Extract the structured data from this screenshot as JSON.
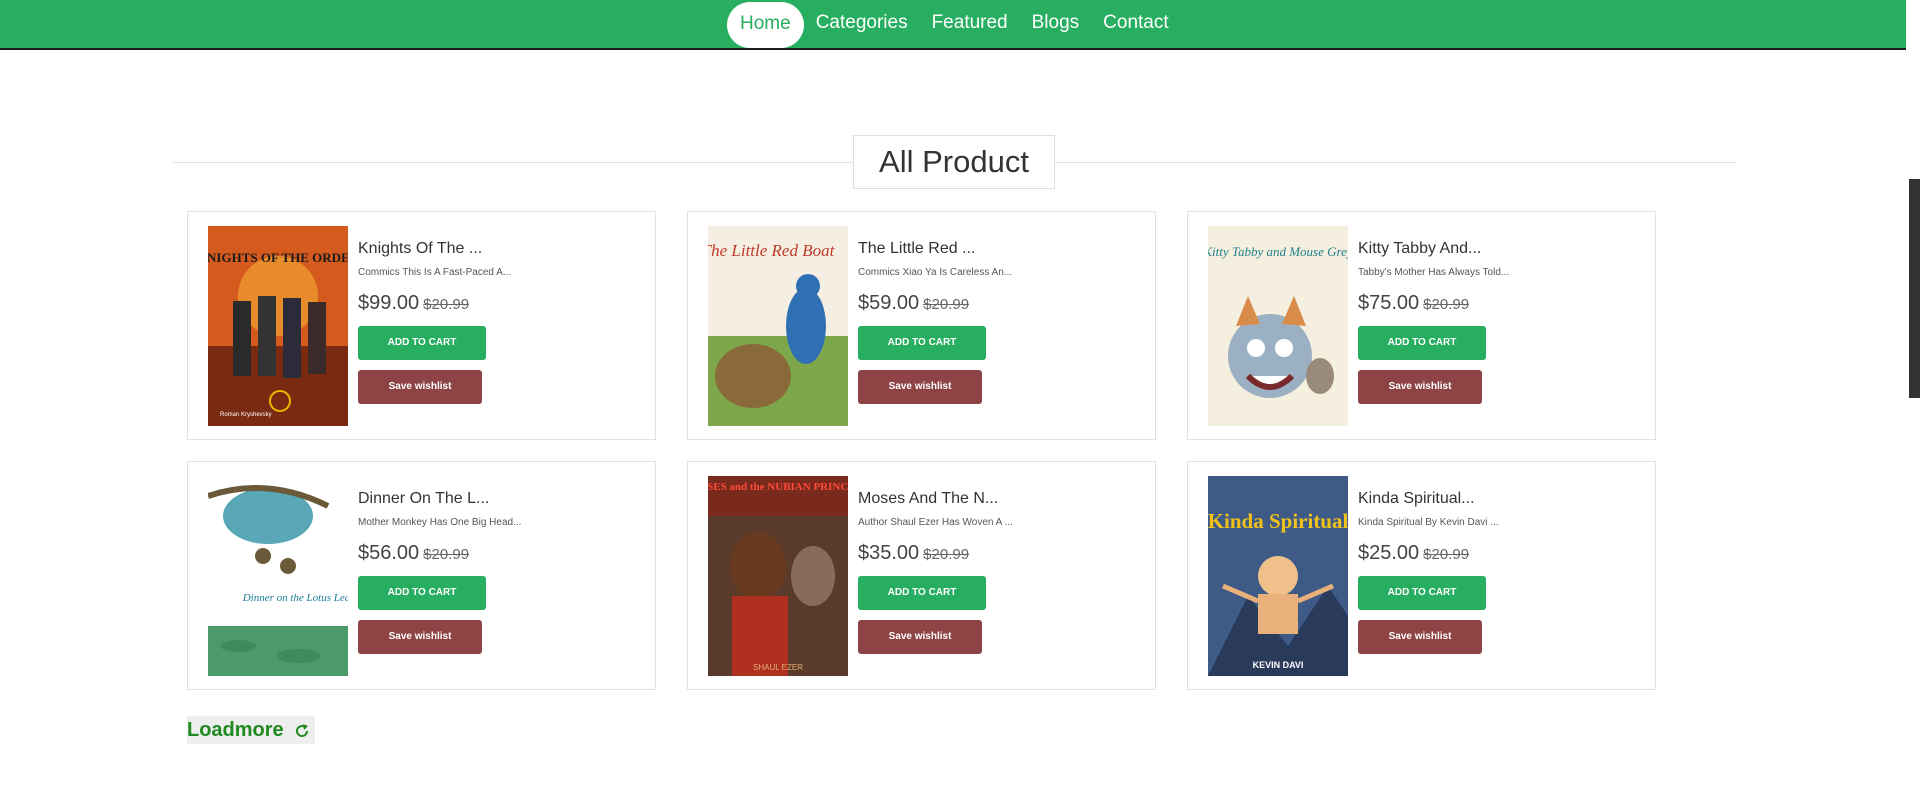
{
  "nav": {
    "items": [
      {
        "label": "Home",
        "active": true
      },
      {
        "label": "Categories"
      },
      {
        "label": "Featured"
      },
      {
        "label": "Blogs"
      },
      {
        "label": "Contact"
      }
    ]
  },
  "section": {
    "title": "All Product"
  },
  "products": [
    {
      "title": "Knights Of The ...",
      "description": "Commics This Is A Fast-Paced A...",
      "price": "$99.00",
      "old_price": "$20.99",
      "cart_label": "ADD TO CART",
      "wishlist_label": "Save wishlist",
      "cover": {
        "icon": "book-cover-knights",
        "text": "KNIGHTS OF THE ORDER",
        "author": "Roman Kryshevsky",
        "bg": "#d45a1e"
      }
    },
    {
      "title": "The Little Red ...",
      "description": "Commics Xiao Ya Is Careless An...",
      "price": "$59.00",
      "old_price": "$20.99",
      "cart_label": "ADD TO CART",
      "wishlist_label": "Save wishlist",
      "cover": {
        "icon": "book-cover-little-red-boat",
        "text": "The Little Red Boat",
        "bg": "#f4efe2"
      }
    },
    {
      "title": "Kitty Tabby And...",
      "description": "Tabby's Mother Has Always Told...",
      "price": "$75.00",
      "old_price": "$20.99",
      "cart_label": "ADD TO CART",
      "wishlist_label": "Save wishlist",
      "cover": {
        "icon": "book-cover-kitty-tabby",
        "text": "Kitty Tabby and Mouse Grey",
        "bg": "#f5efe0"
      }
    },
    {
      "title": "Dinner On The L...",
      "description": "Mother Monkey Has One Big Head...",
      "price": "$56.00",
      "old_price": "$20.99",
      "cart_label": "ADD TO CART",
      "wishlist_label": "Save wishlist",
      "cover": {
        "icon": "book-cover-dinner-lotus",
        "text": "Dinner on the Lotus Leaf",
        "bg": "#ffffff"
      }
    },
    {
      "title": "Moses And The N...",
      "description": "Author Shaul Ezer Has Woven A ...",
      "price": "$35.00",
      "old_price": "$20.99",
      "cart_label": "ADD TO CART",
      "wishlist_label": "Save wishlist",
      "cover": {
        "icon": "book-cover-moses",
        "text": "MOSES and the NUBIAN PRINCESS",
        "author": "SHAUL EZER",
        "bg": "#7a2a1c"
      }
    },
    {
      "title": "Kinda Spiritual...",
      "description": "Kinda Spiritual By Kevin Davi ...",
      "price": "$25.00",
      "old_price": "$20.99",
      "cart_label": "ADD TO CART",
      "wishlist_label": "Save wishlist",
      "cover": {
        "icon": "book-cover-kinda-spiritual",
        "text": "Kinda Spiritual",
        "author": "KEVIN DAVI",
        "bg": "#3e5a86"
      }
    }
  ],
  "loadmore": {
    "label": "Loadmore",
    "icon": "refresh-icon"
  },
  "colors": {
    "nav_bg": "#27ae60",
    "cart_btn": "#27ae60",
    "wishlist_btn": "#8e4444",
    "loadmore_text": "#1f8a1f"
  }
}
